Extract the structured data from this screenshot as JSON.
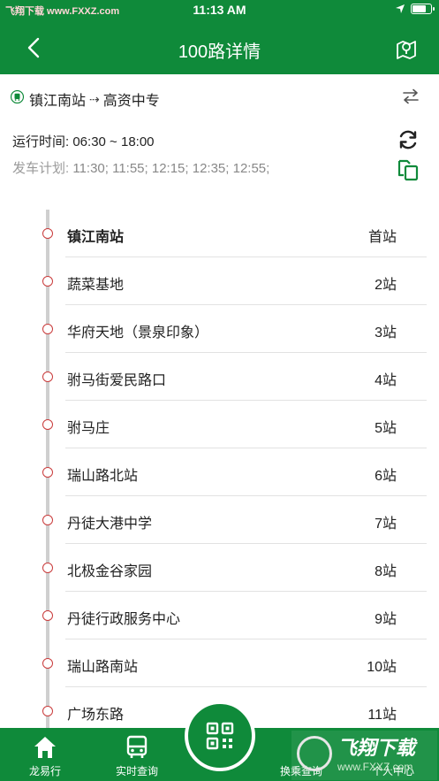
{
  "status_bar": {
    "left_text": "飞翔下载 www.FXXZ.com",
    "time": "11:13 AM",
    "battery_level": 0.8
  },
  "nav": {
    "title": "100路详情"
  },
  "route": {
    "from": "镇江南站",
    "arrow": "⇢",
    "to": "高资中专"
  },
  "info": {
    "hours_label": "运行时间:",
    "hours_value": "06:30 ~ 18:00",
    "plan_label": "发车计划:",
    "plan_value": "11:30; 11:55; 12:15; 12:35; 12:55;"
  },
  "stops": [
    {
      "name": "镇江南站",
      "index": "首站"
    },
    {
      "name": "蔬菜基地",
      "index": "2站"
    },
    {
      "name": "华府天地（景泉印象）",
      "index": "3站"
    },
    {
      "name": "驸马街爱民路口",
      "index": "4站"
    },
    {
      "name": "驸马庄",
      "index": "5站"
    },
    {
      "name": "瑞山路北站",
      "index": "6站"
    },
    {
      "name": "丹徒大港中学",
      "index": "7站"
    },
    {
      "name": "北极金谷家园",
      "index": "8站"
    },
    {
      "name": "丹徒行政服务中心",
      "index": "9站"
    },
    {
      "name": "瑞山路南站",
      "index": "10站"
    },
    {
      "name": "广场东路",
      "index": "11站"
    }
  ],
  "tabs": [
    {
      "label": "龙易行",
      "icon": "home-icon"
    },
    {
      "label": "实时查询",
      "icon": "bus-icon"
    },
    {
      "label": "",
      "icon": "qr-scan-icon"
    },
    {
      "label": "换乘查询",
      "icon": "transfer-icon"
    },
    {
      "label": "个人中心",
      "icon": "user-icon"
    }
  ],
  "watermark": {
    "title": "飞翔下载",
    "url": "www.FXXZ.com"
  },
  "colors": {
    "primary": "#0f8a3a",
    "stop_dot": "#c93b3b",
    "route_line": "#cfcfcf"
  }
}
